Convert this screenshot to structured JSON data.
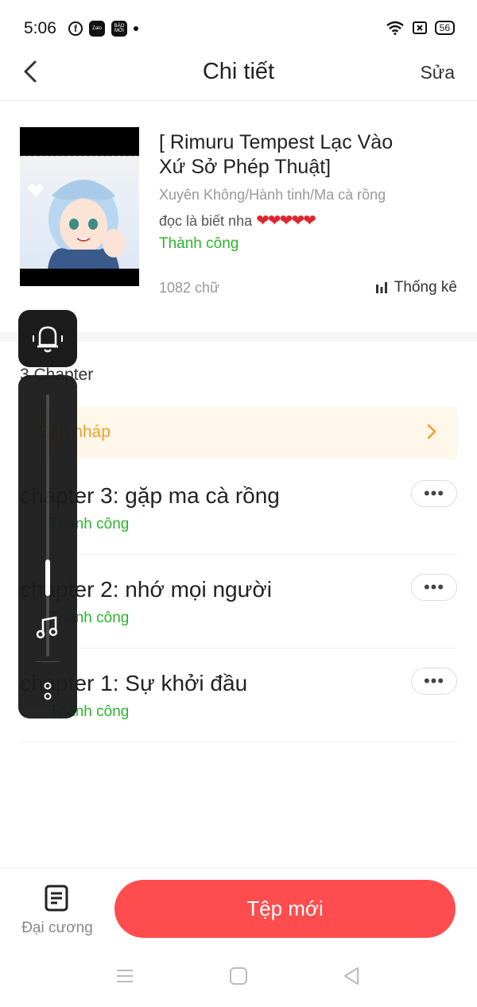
{
  "status_bar": {
    "time": "5:06",
    "apps": [
      "f",
      "Zalo",
      "BÁO MỚI"
    ],
    "battery": "56"
  },
  "header": {
    "title": "Chi tiết",
    "edit_label": "Sửa"
  },
  "book": {
    "title": "[ Rimuru Tempest Lạc Vào Xứ Sở Phép Thuật]",
    "genre": "Xuyên Không/Hành tinh/Ma cà rồng",
    "description": "đọc là biết nha",
    "hearts": "❤❤❤❤❤",
    "status": "Thành công",
    "word_count": "1082 chữ",
    "stats_label": "Thống kê"
  },
  "chapters_section": {
    "count_label": "3 Chapter",
    "draft_label": "Bản nháp",
    "items": [
      {
        "title": "chapter 3: gặp ma cà rồng",
        "status": "Thành công"
      },
      {
        "title": "chapter 2: nhớ mọi người",
        "status": "Thành công"
      },
      {
        "title": "chapter 1: Sự khởi đầu",
        "status": "Thành công"
      }
    ]
  },
  "bottom": {
    "outline_label": "Đại cương",
    "new_button_label": "Tệp mới"
  },
  "colors": {
    "accent": "#ff4d4f",
    "success": "#2cb52c",
    "draft_bg": "#fff7ea",
    "draft_text": "#f0a02a",
    "hearts": "#e0252e"
  },
  "icons": [
    "back-icon",
    "bell-icon",
    "music-icon",
    "more-icon",
    "outline-icon",
    "chart-icon",
    "chevron-right-icon",
    "wifi-icon"
  ],
  "volume_level": 0.3
}
